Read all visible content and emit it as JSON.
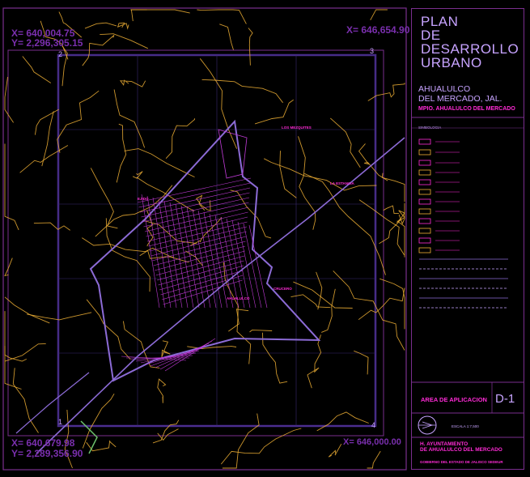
{
  "title_lines": [
    "PLAN",
    "DE",
    "DESARROLLO",
    "URBANO"
  ],
  "place_lines": [
    "AHUALULCO",
    "DEL MERCADO, JAL."
  ],
  "municipality": "MPIO. AHUALULCO DEL MERCADO",
  "legend_heading": "SIMBOLOGIA",
  "plan_code": "D-1",
  "plan_name": "AREA DE APLICACION",
  "scale": "ESCALA 1:7,500",
  "authority_lines": [
    "H. AYUNTAMIENTO",
    "DE AHUALULCO DEL MERCADO"
  ],
  "government": "GOBIERNO DEL ESTADO DE JALISCO SEDEUR",
  "coords": {
    "top_left_1": "X= 640,004.75",
    "top_left_2": "Y= 2,296,305.15",
    "top_right": "X= 646,654.90",
    "bottom_left_1": "X= 640,679.98",
    "bottom_left_2": "Y= 2,289,356.90",
    "bottom_right": "X= 646,000.00"
  },
  "grid_numbers": [
    "2",
    "3",
    "1",
    "4"
  ],
  "map_labels": [
    "LOS MEZQUITES",
    "LA ESTANCIA",
    "EJIDO",
    "AHUALULCO",
    "CRUCERO"
  ],
  "colors": {
    "roads": "#f0b035",
    "boundary": "#8c6bd6",
    "urban": "#c13bd8",
    "accent": "#ff2bd6",
    "frame": "#7a2e8e"
  }
}
